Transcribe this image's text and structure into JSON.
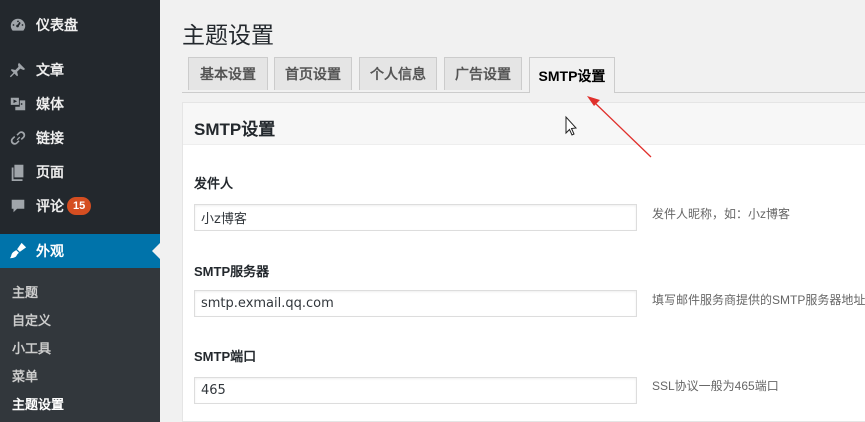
{
  "sidebar": {
    "items": [
      {
        "icon": "dashboard-icon",
        "label": "仪表盘"
      },
      {
        "icon": "pin-icon",
        "label": "文章"
      },
      {
        "icon": "media-icon",
        "label": "媒体"
      },
      {
        "icon": "link-icon",
        "label": "链接"
      },
      {
        "icon": "page-icon",
        "label": "页面"
      },
      {
        "icon": "comment-icon",
        "label": "评论",
        "badge": "15"
      },
      {
        "icon": "brush-icon",
        "label": "外观"
      }
    ],
    "submenu": [
      "主题",
      "自定义",
      "小工具",
      "菜单",
      "主题设置"
    ]
  },
  "page": {
    "title": "主题设置"
  },
  "tabs": [
    "基本设置",
    "首页设置",
    "个人信息",
    "广告设置",
    "SMTP设置"
  ],
  "panel": {
    "title": "SMTP设置",
    "fields": [
      {
        "label": "发件人",
        "value": "小z博客",
        "desc": "发件人昵称，如：小z博客"
      },
      {
        "label": "SMTP服务器",
        "value": "smtp.exmail.qq.com",
        "desc": "填写邮件服务商提供的SMTP服务器地址"
      },
      {
        "label": "SMTP端口",
        "value": "465",
        "desc": "SSL协议一般为465端口"
      }
    ]
  },
  "colors": {
    "sidebar": "#23282d",
    "submenu": "#32373c",
    "accent": "#0073aa",
    "badge": "#d54e21",
    "annotation": "#e0302c"
  }
}
